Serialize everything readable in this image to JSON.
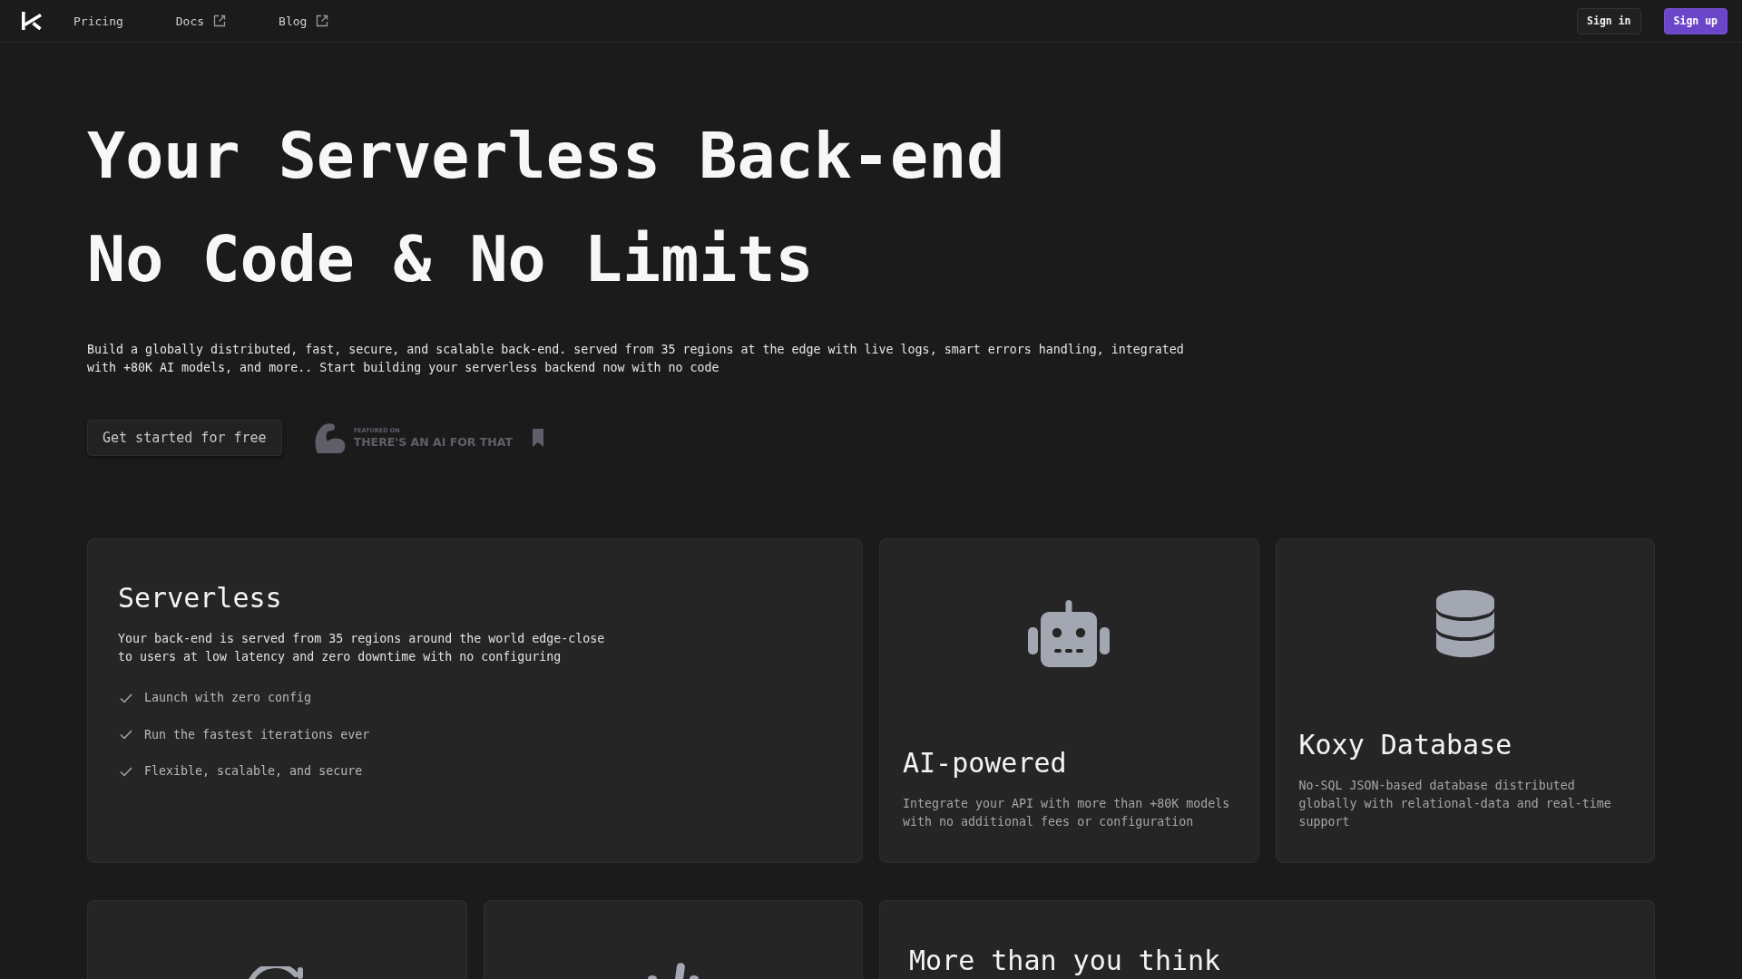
{
  "nav": {
    "links": [
      {
        "label": "Pricing",
        "external": false
      },
      {
        "label": "Docs",
        "external": true
      },
      {
        "label": "Blog",
        "external": true
      }
    ],
    "sign_in": "Sign in",
    "sign_up": "Sign up"
  },
  "hero": {
    "title_lines": [
      "Your Serverless Back-end",
      "No Code & No Limits"
    ],
    "description": "Build a globally distributed, fast, secure, and scalable back-end. served from 35 regions at the edge with live logs, smart errors handling, integrated with +80K AI models, and more.. Start building your serverless backend now with no code",
    "cta": "Get started for free",
    "badge": {
      "overline": "FEATURED ON",
      "name": "THERE'S AN AI FOR THAT"
    }
  },
  "features": [
    {
      "kind": "checklist",
      "title": "Serverless",
      "description": "Your back-end is served from 35 regions around the world edge-close to users at low latency and zero downtime with no configuring",
      "items": [
        "Launch with zero config",
        "Run the fastest iterations ever",
        "Flexible, scalable, and secure"
      ]
    },
    {
      "kind": "icon",
      "title": "AI-powered",
      "description": "Integrate your API with more than +80K models with no additional fees or configuration"
    },
    {
      "kind": "icon",
      "title": "Koxy Database",
      "description": "No-SQL JSON-based database distributed globally with relational-data and real-time support"
    },
    {
      "kind": "icon"
    },
    {
      "kind": "icon"
    },
    {
      "kind": "heading",
      "title": "More than you think"
    }
  ]
}
